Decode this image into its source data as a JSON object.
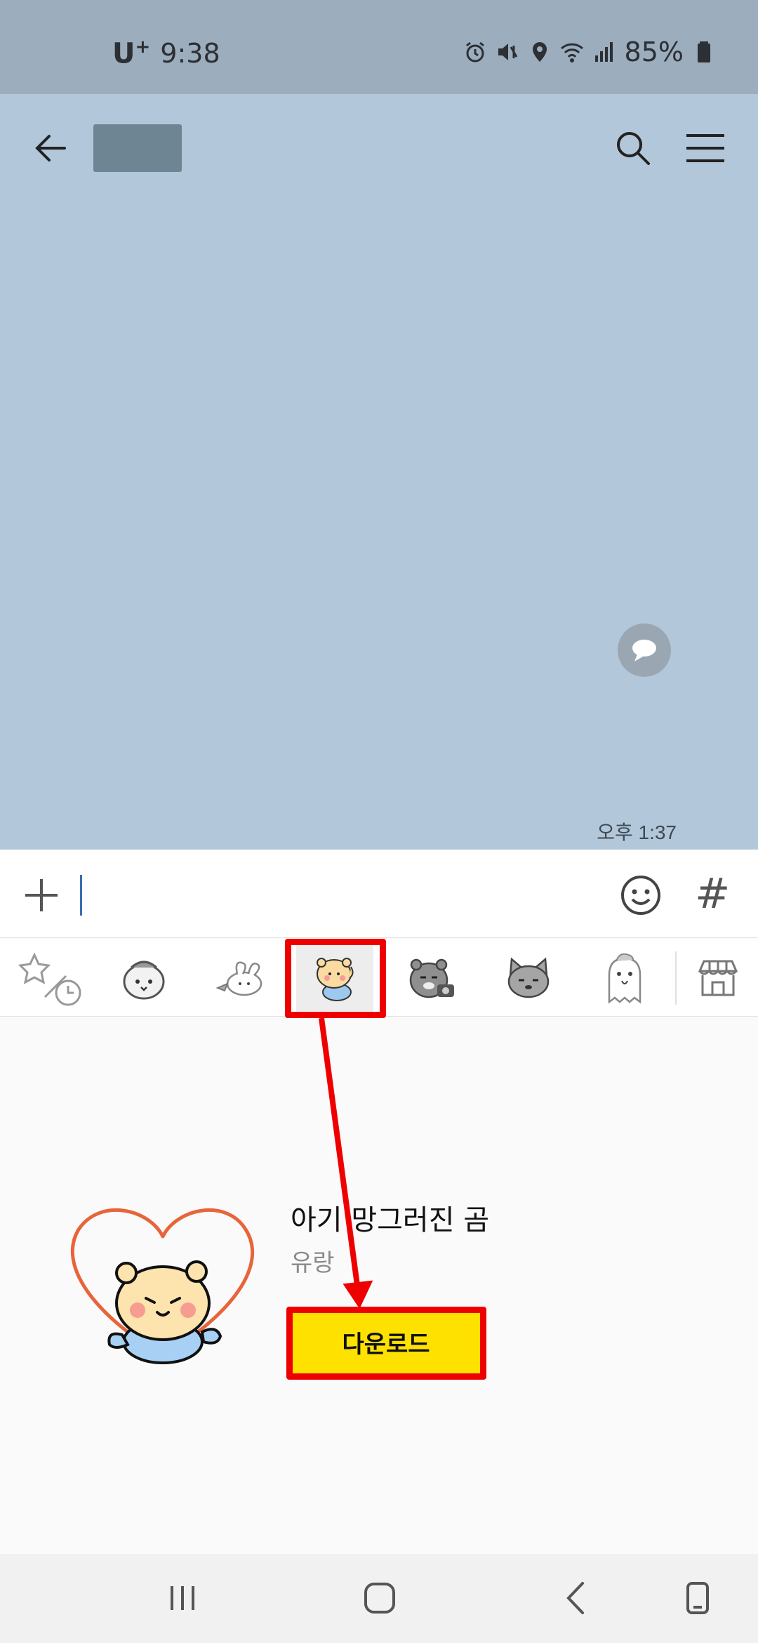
{
  "status_bar": {
    "carrier": "U",
    "carrier_sup": "+",
    "time": "9:38",
    "battery": "85%",
    "icons": [
      "alarm-icon",
      "mute-vibrate-icon",
      "location-icon",
      "wifi-icon",
      "signal-icon",
      "battery-icon"
    ]
  },
  "chat": {
    "timestamp": "오후 1:37"
  },
  "sticker_tabs": {
    "items": [
      "recent-favorites",
      "sticker-cat",
      "sticker-bunny",
      "sticker-bear",
      "sticker-ryan-camera",
      "sticker-cat-gray",
      "sticker-ghost",
      "emoticon-shop"
    ],
    "selected_index": 3
  },
  "sticker_pack": {
    "title": "아기 망그러진 곰",
    "author": "유랑",
    "download_label": "다운로드"
  },
  "colors": {
    "chat_bg": "#b2c7d9",
    "status_bg": "#9cadbd",
    "download_bg": "#ffe100",
    "annotation": "#ee0000"
  }
}
